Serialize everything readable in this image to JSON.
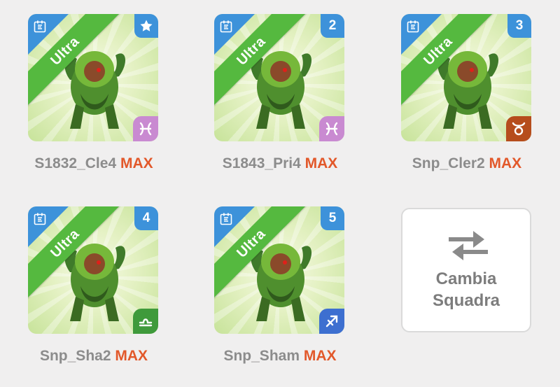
{
  "cards": [
    {
      "rarity": "Ultra",
      "corner_icon": "star-icon",
      "corner_text": "",
      "sign": "pisces",
      "sign_color": "#c98ad1",
      "name": "S1832_Cle4",
      "max": "MAX"
    },
    {
      "rarity": "Ultra",
      "corner_icon": "",
      "corner_text": "2",
      "sign": "pisces",
      "sign_color": "#c98ad1",
      "name": "S1843_Pri4",
      "max": "MAX"
    },
    {
      "rarity": "Ultra",
      "corner_icon": "",
      "corner_text": "3",
      "sign": "taurus",
      "sign_color": "#b64d1c",
      "name": "Snp_Cler2",
      "max": "MAX"
    },
    {
      "rarity": "Ultra",
      "corner_icon": "",
      "corner_text": "4",
      "sign": "libra",
      "sign_color": "#3f9a3b",
      "name": "Snp_Sha2",
      "max": "MAX"
    },
    {
      "rarity": "Ultra",
      "corner_icon": "",
      "corner_text": "5",
      "sign": "sagittarius",
      "sign_color": "#3d6fd0",
      "name": "Snp_Sham",
      "max": "MAX"
    }
  ],
  "swap_team": {
    "line1": "Cambia",
    "line2": "Squadra",
    "icon": "swap-arrows-icon"
  },
  "colors": {
    "corner_blue": "#3d92da",
    "ribbon_green": "#55b93f",
    "max_orange": "#e2582a",
    "name_gray": "#8c8c8c"
  }
}
